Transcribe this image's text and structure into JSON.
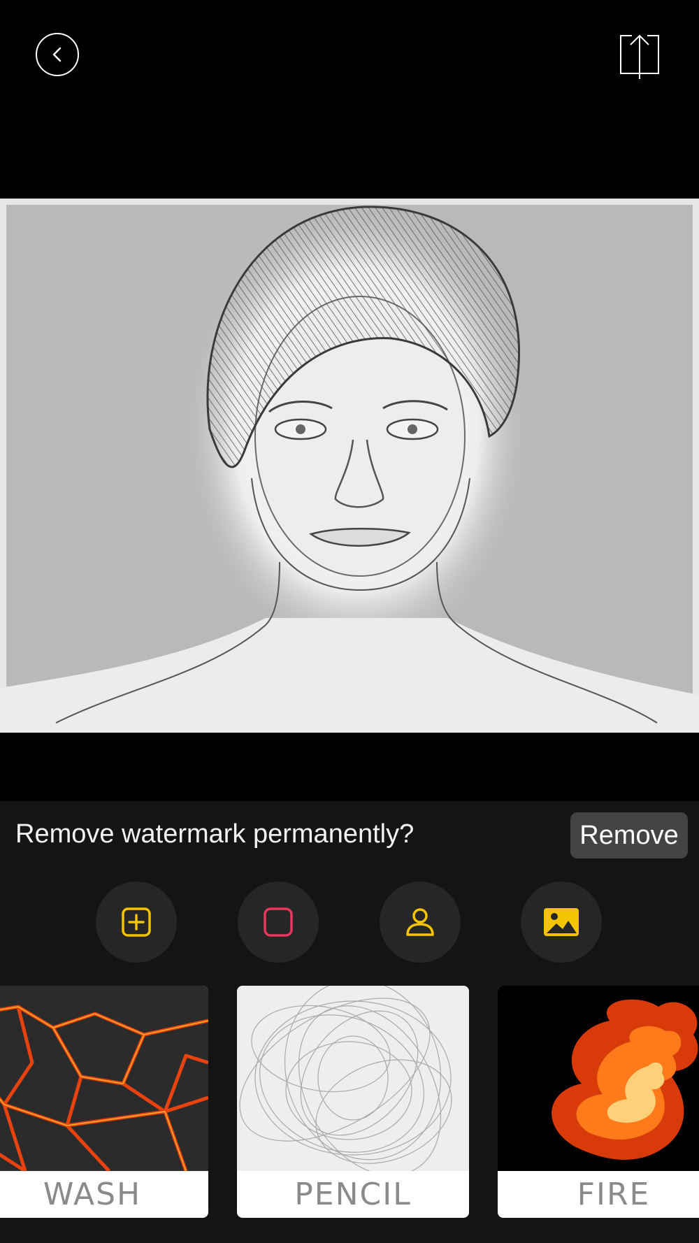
{
  "header": {
    "back_icon": "chevron-left-icon",
    "share_icon": "share-upload-icon"
  },
  "watermark": {
    "prompt": "Remove watermark permanently?",
    "button_label": "Remove"
  },
  "tools": [
    {
      "icon": "add-square-icon",
      "color": "#f5c400"
    },
    {
      "icon": "square-outline-icon",
      "color": "#e8365d"
    },
    {
      "icon": "person-icon",
      "color": "#f5c400"
    },
    {
      "icon": "image-icon",
      "color": "#f5c400"
    }
  ],
  "styles": [
    {
      "label": "WASH"
    },
    {
      "label": "PENCIL"
    },
    {
      "label": "FIRE"
    }
  ]
}
